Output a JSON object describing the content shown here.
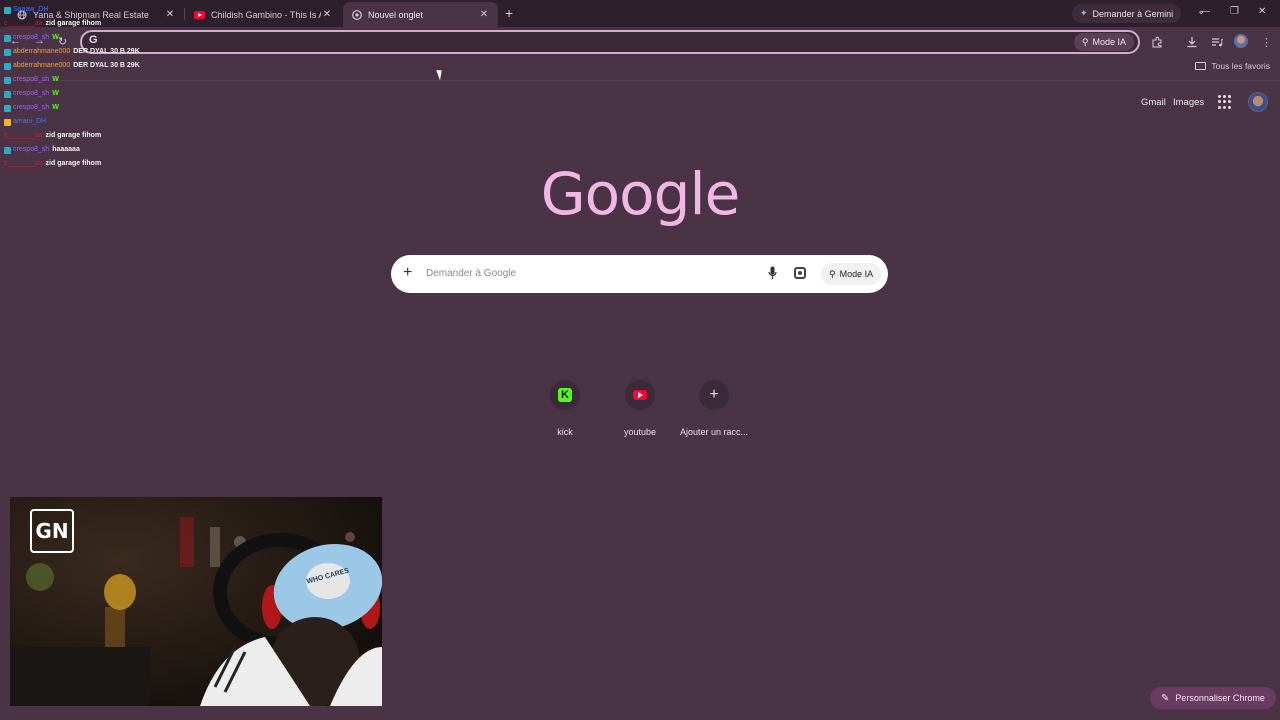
{
  "tabs": [
    {
      "title": "Yana & Shipman Real Estate",
      "active": false,
      "favicon": "globe-icon"
    },
    {
      "title": "Childish Gambino - This Is America",
      "active": false,
      "favicon": "youtube-icon"
    },
    {
      "title": "Nouvel onglet",
      "active": true,
      "favicon": "chrome-icon"
    }
  ],
  "gemini_button": "Demander à Gemini",
  "omnibox": {
    "value": "",
    "mode_label": "Mode IA"
  },
  "bookmarks": {
    "label": "Tous les favoris"
  },
  "top_links": {
    "gmail": "Gmail",
    "images": "Images"
  },
  "logo_text": "Google",
  "search": {
    "placeholder": "Demander à Google",
    "mode_label": "Mode IA"
  },
  "shortcuts": [
    {
      "label": "kick",
      "icon": "kick-icon"
    },
    {
      "label": "youtube",
      "icon": "youtube-icon"
    },
    {
      "label": "Ajouter un racc...",
      "icon": "plus-icon"
    }
  ],
  "customize_label": "Personnaliser Chrome",
  "chat": [
    {
      "user": "Saaaw_DH",
      "user_color": "#3d7bff",
      "msg": ""
    },
    {
      "user": "c_______aa",
      "user_color": "#d4183a",
      "msg": "zid garage fihom"
    },
    {
      "user": "crespo8_sh",
      "user_color": "#b05cff",
      "msg": "W"
    },
    {
      "user": "abderrahmane000",
      "user_color": "#ff9e2c",
      "msg": "DER DYAL 30 B 29K"
    },
    {
      "user": "abderrahmane000",
      "user_color": "#ff9e2c",
      "msg": "DER DYAL 30 B 29K"
    },
    {
      "user": "crespo8_sh",
      "user_color": "#b05cff",
      "msg": "W"
    },
    {
      "user": "crespo8_sh",
      "user_color": "#b05cff",
      "msg": "W"
    },
    {
      "user": "crespo8_sh",
      "user_color": "#b05cff",
      "msg": "W"
    },
    {
      "user": "amani_DH",
      "user_color": "#3d7bff",
      "msg": ""
    },
    {
      "user": "c_______aa",
      "user_color": "#d4183a",
      "msg": "zid garage fihom"
    },
    {
      "user": "crespo8_sh",
      "user_color": "#b05cff",
      "msg": "haaaaaa"
    },
    {
      "user": "c_______aa",
      "user_color": "#d4183a",
      "msg": "zid garage fihom"
    }
  ],
  "webcam": {
    "logo_text": "GN",
    "cap_text": "WHO CARES"
  }
}
